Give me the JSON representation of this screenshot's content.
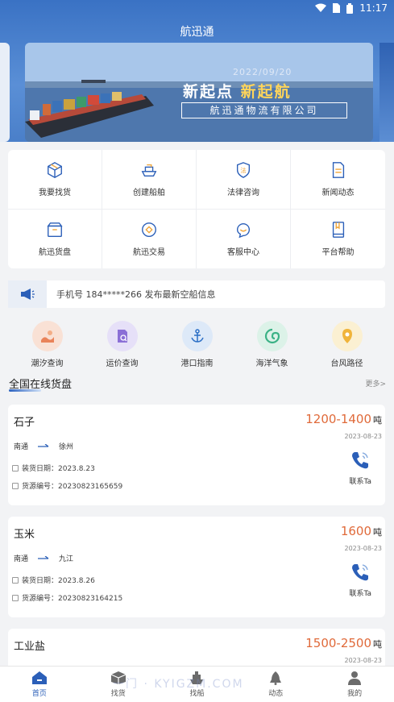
{
  "status_bar": {
    "time": "11:17",
    "icons": [
      "wifi-icon",
      "sim-icon",
      "battery-icon"
    ]
  },
  "app": {
    "title": "航迅通"
  },
  "banner": {
    "date": "2022/09/20",
    "slogan_1": "新起点",
    "slogan_2": "新起航",
    "company": "航迅通物流有限公司"
  },
  "menu": [
    {
      "label": "我要找货",
      "icon": "cargo-box-icon"
    },
    {
      "label": "创建船舶",
      "icon": "ship-icon"
    },
    {
      "label": "法律咨询",
      "icon": "law-shield-icon"
    },
    {
      "label": "新闻动态",
      "icon": "news-doc-icon"
    },
    {
      "label": "航迅货盘",
      "icon": "pallet-icon"
    },
    {
      "label": "航迅交易",
      "icon": "trade-coin-icon"
    },
    {
      "label": "客服中心",
      "icon": "customer-service-icon"
    },
    {
      "label": "平台帮助",
      "icon": "help-book-icon"
    }
  ],
  "notice": {
    "text": "手机号 184*****266 发布最新空船信息"
  },
  "tools": [
    {
      "label": "潮汐查询",
      "icon": "tide-icon",
      "color": "#f6d8c8"
    },
    {
      "label": "运价查询",
      "icon": "freight-price-icon",
      "color": "#e3dcf7"
    },
    {
      "label": "港口指南",
      "icon": "anchor-icon",
      "color": "#dbe8f8"
    },
    {
      "label": "海洋气象",
      "icon": "ocean-weather-icon",
      "color": "#d9f1e6"
    },
    {
      "label": "台风路径",
      "icon": "typhoon-icon",
      "color": "#fbefcf"
    }
  ],
  "section": {
    "title": "全国在线货盘",
    "more": "更多>"
  },
  "cards": [
    {
      "name": "石子",
      "price": "1200-1400",
      "unit": "吨",
      "date": "2023-08-23",
      "from": "南通",
      "to": "徐州",
      "load_date": "装货日期：2023.8.23",
      "source_no": "货源编号：20230823165659",
      "contact": "联系Ta"
    },
    {
      "name": "玉米",
      "price": "1600",
      "unit": "吨",
      "date": "2023-08-23",
      "from": "南通",
      "to": "九江",
      "load_date": "装货日期：2023.8.26",
      "source_no": "货源编号：20230823164215",
      "contact": "联系Ta"
    },
    {
      "name": "工业盐",
      "price": "1500-2500",
      "unit": "吨",
      "date": "2023-08-23"
    }
  ],
  "bottom_nav": [
    {
      "label": "首页",
      "icon": "home-icon",
      "active": true
    },
    {
      "label": "找货",
      "icon": "find-cargo-icon",
      "active": false
    },
    {
      "label": "找船",
      "icon": "find-ship-icon",
      "active": false
    },
    {
      "label": "动态",
      "icon": "news-feed-icon",
      "active": false
    },
    {
      "label": "我的",
      "icon": "profile-icon",
      "active": false
    }
  ],
  "watermark": "一门 · KYIGZM.COM",
  "colors": {
    "primary": "#2b5fb8",
    "price": "#e06a3a",
    "header_bg": "#4a7fc9"
  }
}
